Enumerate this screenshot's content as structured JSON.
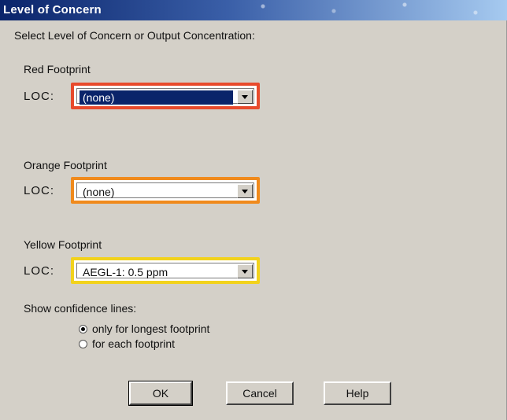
{
  "window": {
    "title": "Level of Concern"
  },
  "instruction": "Select Level of Concern or Output Concentration:",
  "footprints": [
    {
      "group_label": "Red Footprint",
      "loc_label": "LOC:",
      "value": "(none)",
      "border_color": "#e84a2c",
      "selected_highlight": true
    },
    {
      "group_label": "Orange Footprint",
      "loc_label": "LOC:",
      "value": "(none)",
      "border_color": "#f08a1c",
      "selected_highlight": false
    },
    {
      "group_label": "Yellow Footprint",
      "loc_label": "LOC:",
      "value": "AEGL-1: 0.5 ppm",
      "border_color": "#f2d21c",
      "selected_highlight": false
    }
  ],
  "confidence": {
    "label": "Show confidence lines:",
    "options": [
      {
        "label": "only for longest footprint",
        "checked": true
      },
      {
        "label": "for each footprint",
        "checked": false
      }
    ]
  },
  "buttons": {
    "ok": "OK",
    "cancel": "Cancel",
    "help": "Help"
  }
}
